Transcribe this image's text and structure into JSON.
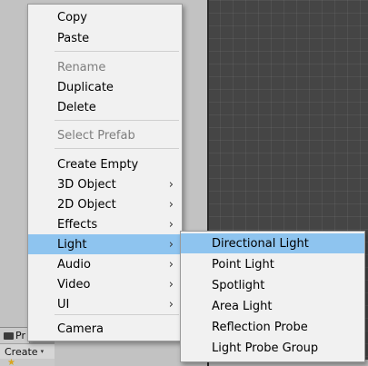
{
  "project_panel": {
    "tab_label": "Pr",
    "create_label": "Create",
    "create_caret": "▾"
  },
  "context_menu": {
    "items": [
      {
        "label": "Copy",
        "disabled": false,
        "submenu": false
      },
      {
        "label": "Paste",
        "disabled": false,
        "submenu": false
      },
      {
        "label": "Rename",
        "disabled": true,
        "submenu": false
      },
      {
        "label": "Duplicate",
        "disabled": false,
        "submenu": false
      },
      {
        "label": "Delete",
        "disabled": false,
        "submenu": false
      },
      {
        "label": "Select Prefab",
        "disabled": true,
        "submenu": false
      },
      {
        "label": "Create Empty",
        "disabled": false,
        "submenu": false
      },
      {
        "label": "3D Object",
        "disabled": false,
        "submenu": true
      },
      {
        "label": "2D Object",
        "disabled": false,
        "submenu": true
      },
      {
        "label": "Effects",
        "disabled": false,
        "submenu": true
      },
      {
        "label": "Light",
        "disabled": false,
        "submenu": true,
        "highlighted": true
      },
      {
        "label": "Audio",
        "disabled": false,
        "submenu": true
      },
      {
        "label": "Video",
        "disabled": false,
        "submenu": true
      },
      {
        "label": "UI",
        "disabled": false,
        "submenu": true
      },
      {
        "label": "Camera",
        "disabled": false,
        "submenu": false
      }
    ],
    "submenu_arrow": "›"
  },
  "light_submenu": {
    "items": [
      {
        "label": "Directional Light",
        "highlighted": true
      },
      {
        "label": "Point Light"
      },
      {
        "label": "Spotlight"
      },
      {
        "label": "Area Light"
      },
      {
        "label": "Reflection Probe"
      },
      {
        "label": "Light Probe Group"
      }
    ]
  },
  "colors": {
    "highlight": "#8ec4ef",
    "menu_background": "#f1f1f1",
    "scene_background": "#454545",
    "disabled_text": "#7e7e7e"
  }
}
